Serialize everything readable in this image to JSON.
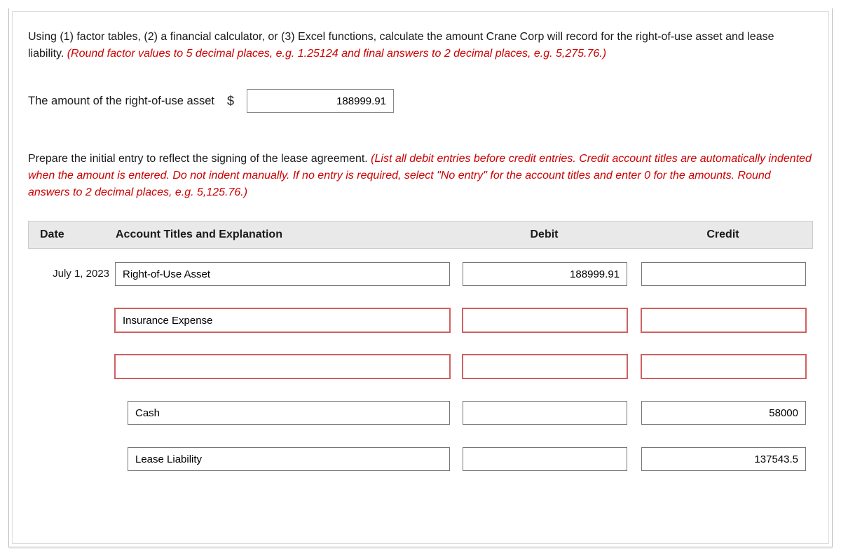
{
  "question1": {
    "lead": "Using (1) factor tables, (2) a financial calculator, or (3) Excel functions, calculate the amount Crane Corp will record for the right-of-use asset and lease liability. ",
    "redNote": "(Round factor values to 5 decimal places, e.g. 1.25124 and final answers to 2 decimal places, e.g. 5,275.76.)"
  },
  "amount": {
    "label": "The amount of the right-of-use asset",
    "currency": "$",
    "value": "188999.91"
  },
  "question2": {
    "lead": "Prepare the initial entry to reflect the signing of the lease agreement. ",
    "redNote": "(List all debit entries before credit entries. Credit account titles are automatically indented when the amount is entered. Do not indent manually. If no entry is required, select \"No entry\" for the account titles and enter 0 for the amounts. Round answers to 2 decimal places, e.g. 5,125.76.)"
  },
  "journal": {
    "headers": {
      "date": "Date",
      "account": "Account Titles and Explanation",
      "debit": "Debit",
      "credit": "Credit"
    },
    "rows": [
      {
        "date": "July 1, 2023",
        "account": "Right-of-Use Asset",
        "debit": "188999.91",
        "credit": "",
        "indent": false,
        "err": false
      },
      {
        "date": "",
        "account": "Insurance Expense",
        "debit": "",
        "credit": "",
        "indent": false,
        "err": true
      },
      {
        "date": "",
        "account": "",
        "debit": "",
        "credit": "",
        "indent": false,
        "err": true
      },
      {
        "date": "",
        "account": "Cash",
        "debit": "",
        "credit": "58000",
        "indent": true,
        "err": false
      },
      {
        "date": "",
        "account": "Lease Liability",
        "debit": "",
        "credit": "137543.5",
        "indent": true,
        "err": false
      }
    ]
  }
}
